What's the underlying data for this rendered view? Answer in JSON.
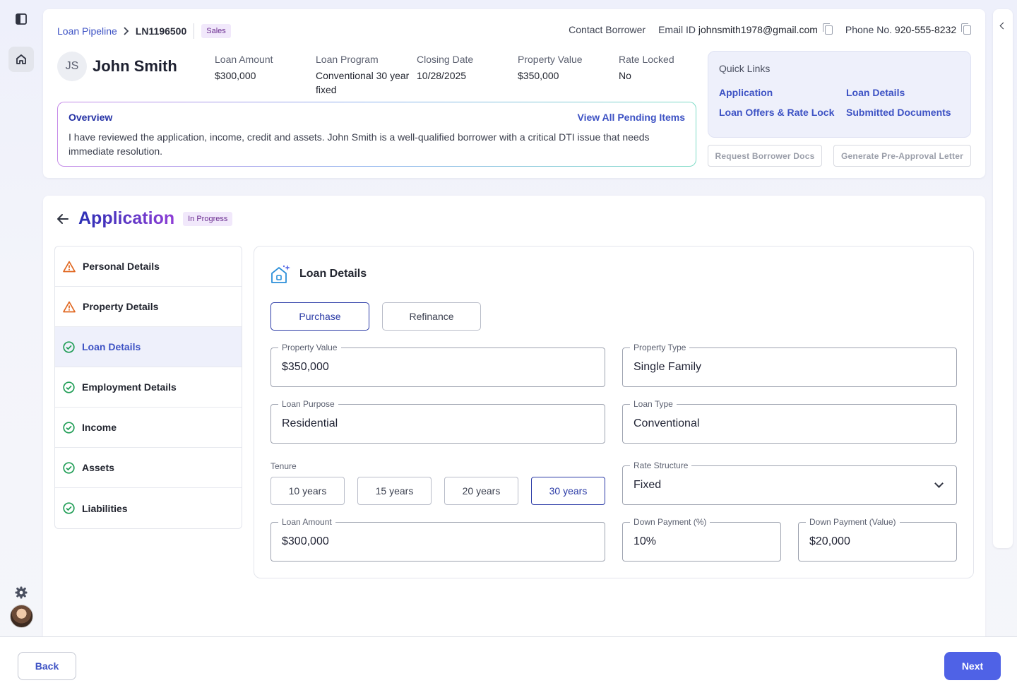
{
  "breadcrumb": {
    "pipeline": "Loan Pipeline",
    "loan_id": "LN1196500",
    "badge": "Sales"
  },
  "contact": {
    "label": "Contact Borrower",
    "email_label": "Email ID",
    "email": "johnsmith1978@gmail.com",
    "phone_label": "Phone No.",
    "phone": "920-555-8232"
  },
  "borrower": {
    "initials": "JS",
    "name": "John Smith"
  },
  "stats": [
    {
      "label": "Loan Amount",
      "value": "$300,000"
    },
    {
      "label": "Loan Program",
      "value": "Conventional 30 year fixed"
    },
    {
      "label": "Closing Date",
      "value": "10/28/2025"
    },
    {
      "label": "Property Value",
      "value": "$350,000"
    },
    {
      "label": "Rate Locked",
      "value": "No"
    }
  ],
  "overview": {
    "title": "Overview",
    "link": "View All Pending Items",
    "text": "I have reviewed the application, income, credit and assets. John Smith is a well-qualified borrower with a critical DTI issue that needs immediate resolution."
  },
  "quick_links": {
    "title": "Quick Links",
    "items": [
      "Application",
      "Loan Details",
      "Loan Offers & Rate Lock",
      "Submitted Documents"
    ]
  },
  "actions": {
    "request_docs": "Request Borrower Docs",
    "pre_approval": "Generate Pre-Approval Letter"
  },
  "application": {
    "title": "Application",
    "status": "In Progress"
  },
  "steps": [
    {
      "label": "Personal Details",
      "status": "warning"
    },
    {
      "label": "Property Details",
      "status": "warning"
    },
    {
      "label": "Loan Details",
      "status": "complete"
    },
    {
      "label": "Employment Details",
      "status": "complete"
    },
    {
      "label": "Income",
      "status": "complete"
    },
    {
      "label": "Assets",
      "status": "complete"
    },
    {
      "label": "Liabilities",
      "status": "complete"
    }
  ],
  "form": {
    "title": "Loan Details",
    "purpose_options": [
      "Purchase",
      "Refinance"
    ],
    "selected_purpose": "Purchase",
    "property_value": {
      "label": "Property Value",
      "value": "$350,000"
    },
    "property_type": {
      "label": "Property Type",
      "value": "Single Family"
    },
    "loan_purpose": {
      "label": "Loan Purpose",
      "value": "Residential"
    },
    "loan_type": {
      "label": "Loan Type",
      "value": "Conventional"
    },
    "tenure": {
      "label": "Tenure",
      "options": [
        "10 years",
        "15 years",
        "20 years",
        "30 years"
      ],
      "selected": "30 years"
    },
    "rate_structure": {
      "label": "Rate Structure",
      "value": "Fixed"
    },
    "loan_amount": {
      "label": "Loan Amount",
      "value": "$300,000"
    },
    "down_payment_pct": {
      "label": "Down Payment (%)",
      "value": "10%"
    },
    "down_payment_value": {
      "label": "Down Payment (Value)",
      "value": "$20,000"
    }
  },
  "footer": {
    "back": "Back",
    "next": "Next"
  },
  "colors": {
    "accent": "#3d52c4",
    "primary_button": "#4f62e6",
    "warning": "#e0661f",
    "success": "#1f9d55"
  },
  "icons": [
    "sidebar-toggle-icon",
    "home-icon",
    "settings-icon",
    "chevron-right-icon",
    "copy-icon",
    "arrow-left-icon",
    "house-sparkle-icon",
    "warning-icon",
    "check-circle-icon",
    "chevron-down-icon",
    "chevron-left-icon"
  ]
}
